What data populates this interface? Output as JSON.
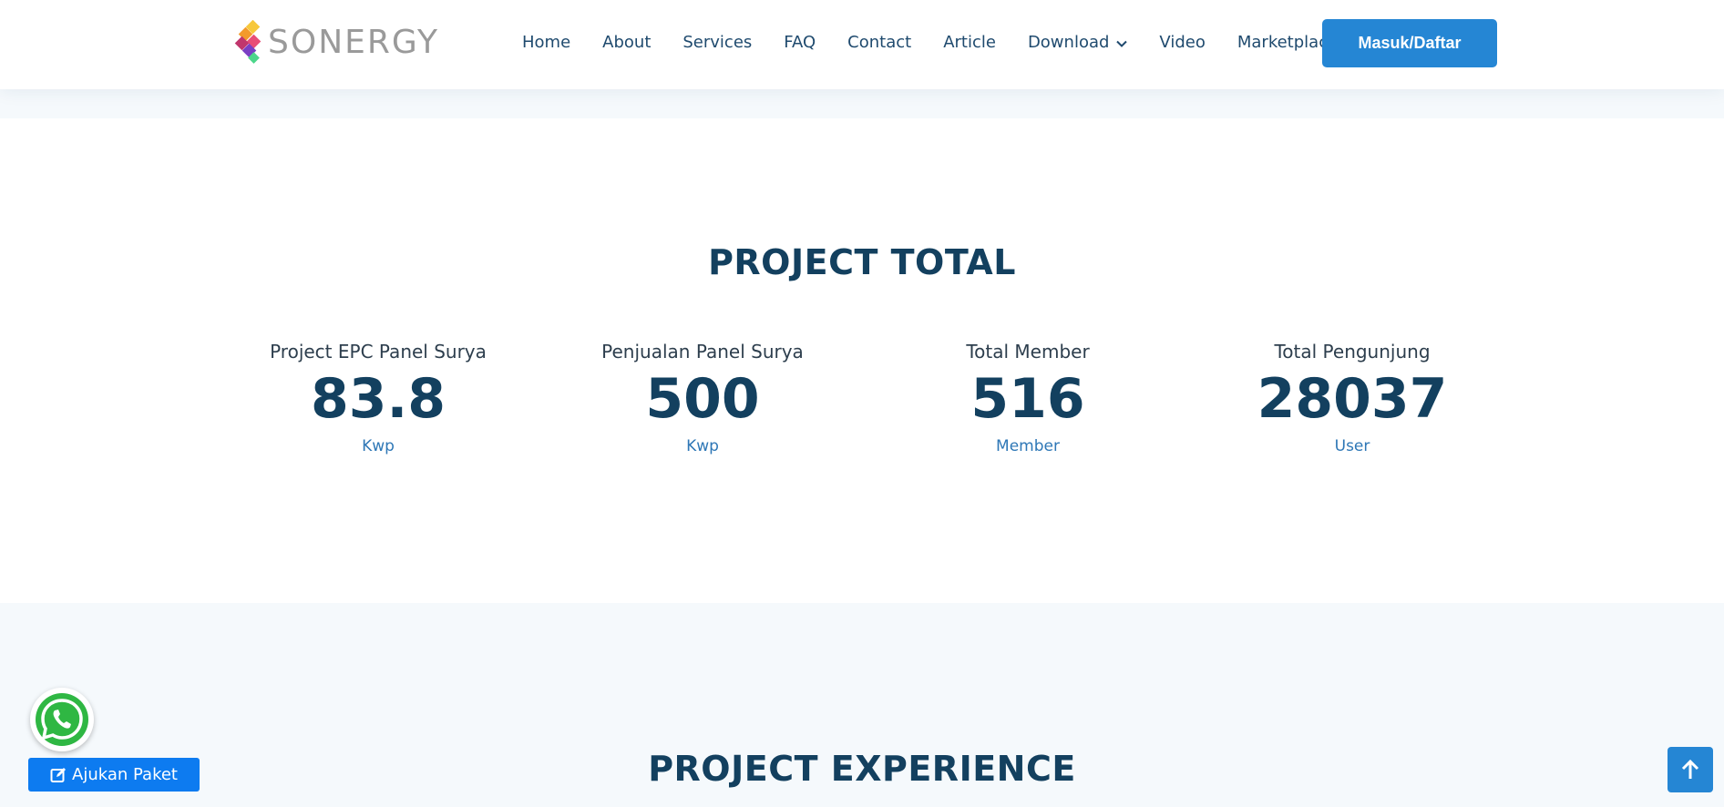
{
  "header": {
    "logo_text": "SONERGY",
    "nav": [
      {
        "label": "Home"
      },
      {
        "label": "About"
      },
      {
        "label": "Services"
      },
      {
        "label": "FAQ"
      },
      {
        "label": "Contact"
      },
      {
        "label": "Article"
      },
      {
        "label": "Download",
        "icon": "chevron-down-icon"
      },
      {
        "label": "Video"
      },
      {
        "label": "Marketplace"
      }
    ],
    "login_label": "Masuk/Daftar"
  },
  "project_total": {
    "title": "PROJECT TOTAL",
    "stats": [
      {
        "label": "Project EPC Panel Surya",
        "value": "83.8",
        "unit": "Kwp"
      },
      {
        "label": "Penjualan Panel Surya",
        "value": "500",
        "unit": "Kwp"
      },
      {
        "label": "Total Member",
        "value": "516",
        "unit": "Member"
      },
      {
        "label": "Total Pengunjung",
        "value": "28037",
        "unit": "User"
      }
    ]
  },
  "project_experience": {
    "title": "PROJECT EXPERIENCE"
  },
  "floating": {
    "whatsapp_icon": "whatsapp-icon",
    "ajukan_label": "Ajukan Paket",
    "back_to_top_icon": "arrow-up-icon"
  },
  "colors": {
    "primary": "#2586d4",
    "heading": "#13405f",
    "unit": "#2e77b6",
    "ajukan": "#0d7bf0",
    "whatsapp": "#2fb743"
  }
}
